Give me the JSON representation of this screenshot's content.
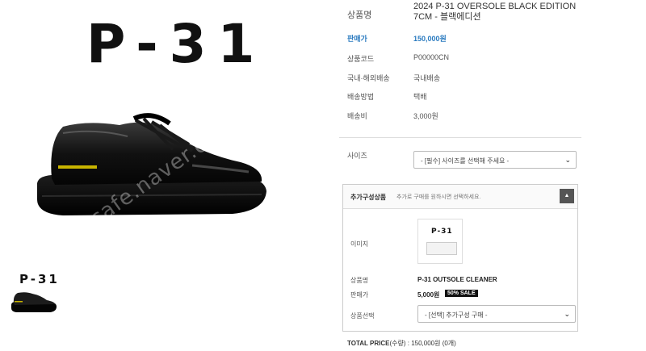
{
  "gallery": {
    "brand_large": "P-31",
    "brand_small": "P-31",
    "watermark_text": "cafe.naver.com"
  },
  "product": {
    "name_label": "상품명",
    "name_value": "2024 P-31 OVERSOLE BLACK EDITION 7CM - 블랙에디션",
    "price_label": "판매가",
    "price_value": "150,000원",
    "code_label": "상품코드",
    "code_value": "P00000CN",
    "shipping_scope_label": "국내·해외배송",
    "shipping_scope_value": "국내배송",
    "shipping_method_label": "배송방법",
    "shipping_method_value": "택배",
    "shipping_fee_label": "배송비",
    "shipping_fee_value": "3,000원"
  },
  "size_option": {
    "label": "사이즈",
    "selected": "- [필수] 사이즈를 선택해 주세요 -"
  },
  "addon": {
    "title": "추가구성상품",
    "description": "추가로 구매를 원하시면 선택하세요.",
    "image_label": "이미지",
    "image_brand": "P-31",
    "name_label": "상품명",
    "name_value": "P-31 OUTSOLE CLEANER",
    "price_label": "판매가",
    "price_value": "5,000원",
    "sale_badge": "50% SALE",
    "select_label": "상품선택",
    "select_selected": "- [선택] 추가구성 구매 -"
  },
  "total": {
    "label": "TOTAL PRICE",
    "qty_label": "(수량)",
    "value": ": 150,000원 (0개)"
  },
  "colors": {
    "accent": "#2b7bc0",
    "badge": "#111111"
  }
}
